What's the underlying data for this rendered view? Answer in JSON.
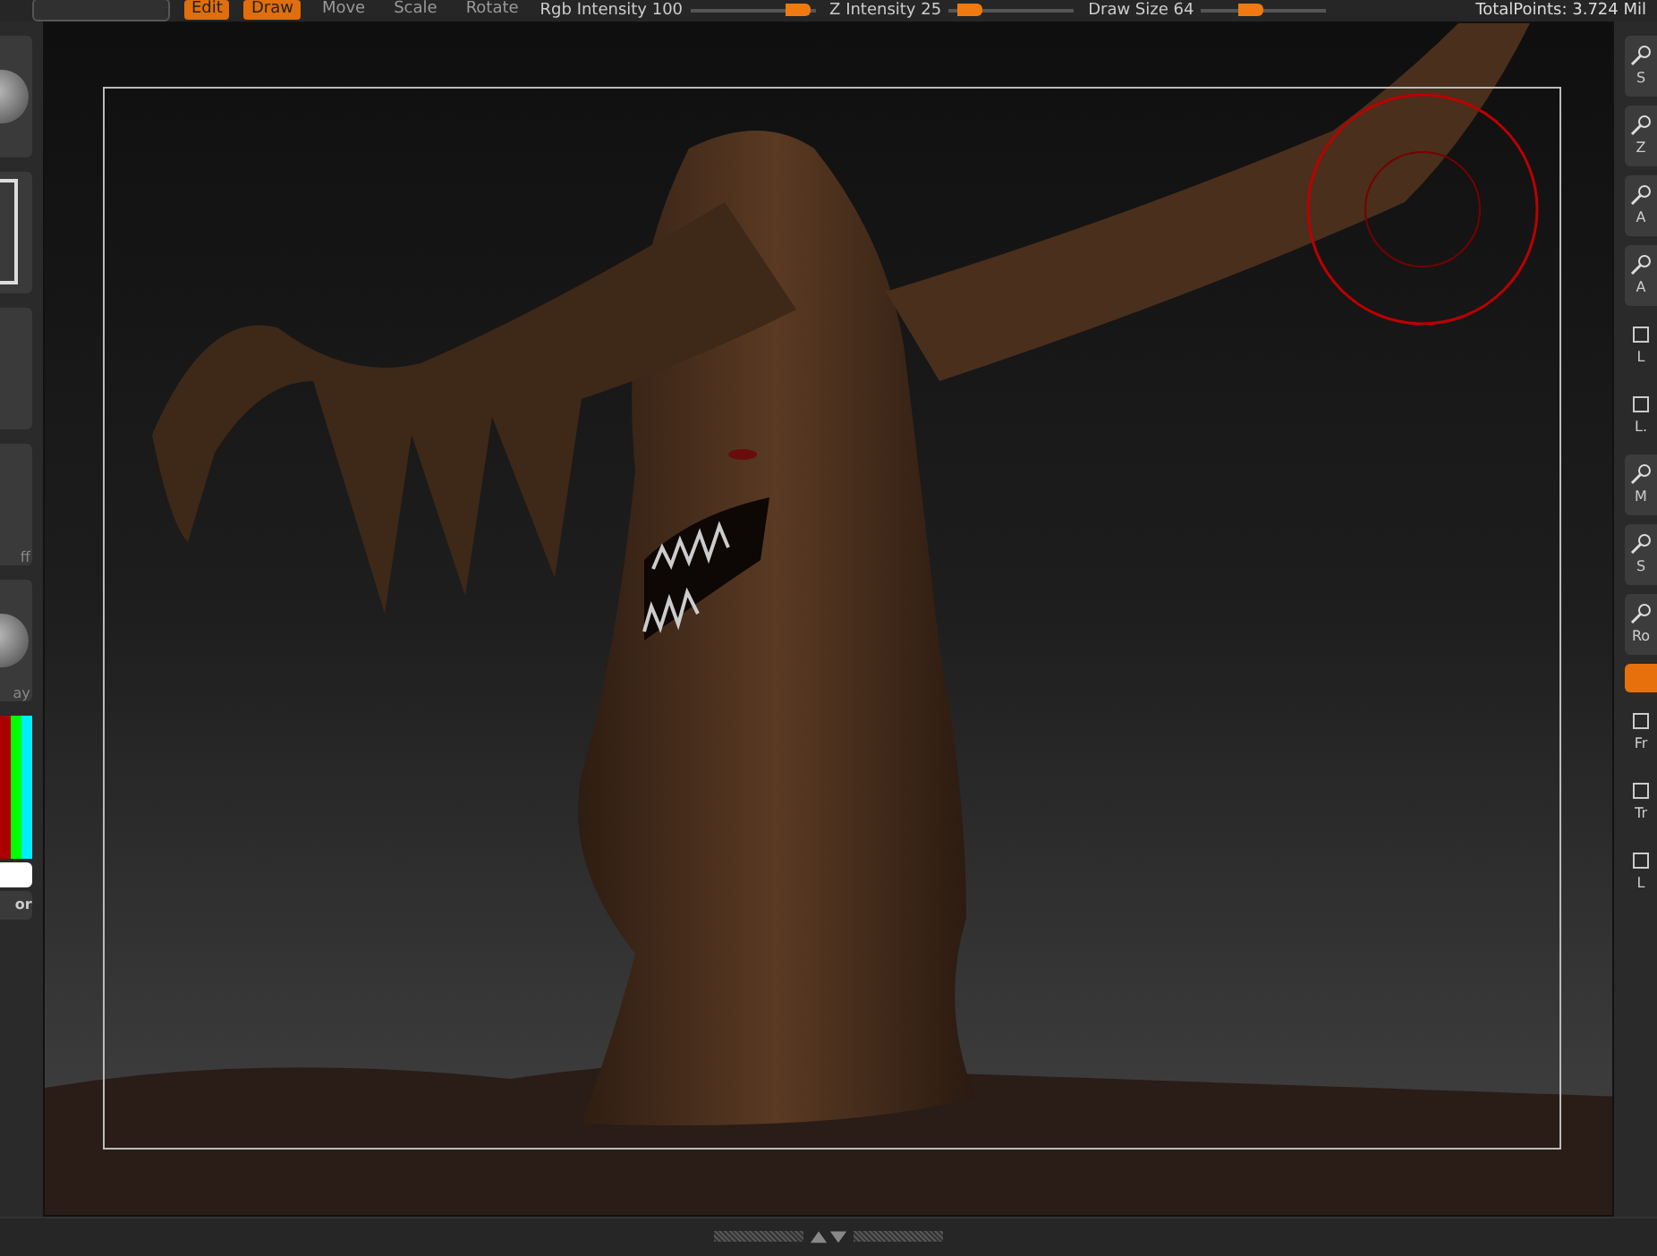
{
  "top_bar": {
    "modes": [
      {
        "label": "Edit",
        "selected": true
      },
      {
        "label": "Draw",
        "selected": true
      },
      {
        "label": "Move",
        "selected": false
      },
      {
        "label": "Scale",
        "selected": false
      },
      {
        "label": "Rotate",
        "selected": false
      }
    ],
    "sliders": [
      {
        "label": "Rgb Intensity 100",
        "level": 0.97
      },
      {
        "label": "Z Intensity 25",
        "level": 0.27
      },
      {
        "label": "Draw Size 64",
        "level": 0.5
      }
    ],
    "total_points": "TotalPoints: 3.724 Mil"
  },
  "left_panel": {
    "tiles": [
      {
        "kind": "sphere"
      },
      {
        "kind": "square"
      },
      {
        "kind": "blank"
      },
      {
        "kind": "blank",
        "label": "ff"
      },
      {
        "kind": "sphere",
        "label": "ay"
      }
    ],
    "color_button": "or"
  },
  "right_shelf": [
    {
      "kind": "button",
      "label": "S"
    },
    {
      "kind": "button",
      "label": "Z"
    },
    {
      "kind": "button",
      "label": "A"
    },
    {
      "kind": "button",
      "label": "A"
    },
    {
      "kind": "plain",
      "label": "L"
    },
    {
      "kind": "plain",
      "label": "L."
    },
    {
      "kind": "button",
      "label": "M"
    },
    {
      "kind": "button",
      "label": "S"
    },
    {
      "kind": "button",
      "label": "Ro"
    },
    {
      "kind": "toggle",
      "on": true
    },
    {
      "kind": "plain",
      "label": "Fr"
    },
    {
      "kind": "plain",
      "label": "Tr"
    },
    {
      "kind": "plain",
      "label": "L"
    }
  ]
}
